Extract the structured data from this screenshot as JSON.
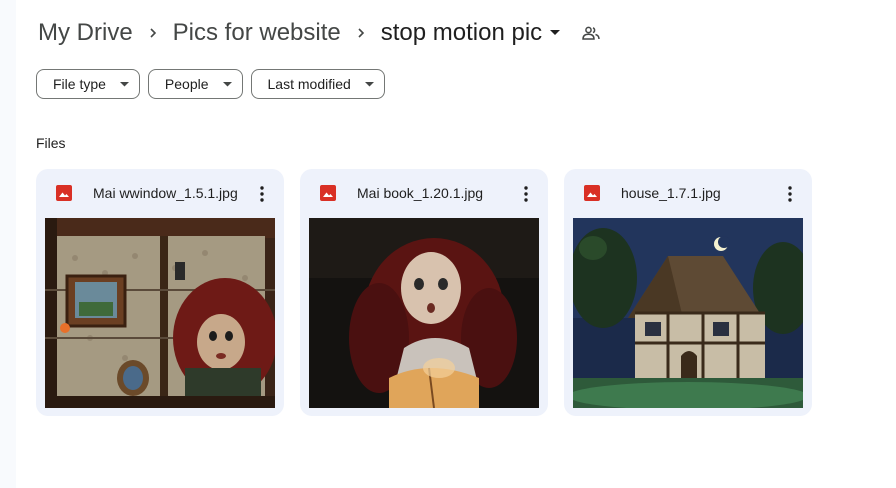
{
  "breadcrumb": {
    "items": [
      "My Drive",
      "Pics for website"
    ],
    "current": "stop motion pic"
  },
  "filters": [
    "File type",
    "People",
    "Last modified"
  ],
  "section_label": "Files",
  "files": [
    {
      "name": "Mai wwindow_1.5.1.jpg",
      "icon": "image-file-icon"
    },
    {
      "name": "Mai book_1.20.1.jpg",
      "icon": "image-file-icon"
    },
    {
      "name": "house_1.7.1.jpg",
      "icon": "image-file-icon"
    }
  ],
  "colors": {
    "accent_red": "#d93025",
    "card_bg": "#eef2fb",
    "page_bg": "#ffffff",
    "side_bg": "#f8fafd"
  }
}
